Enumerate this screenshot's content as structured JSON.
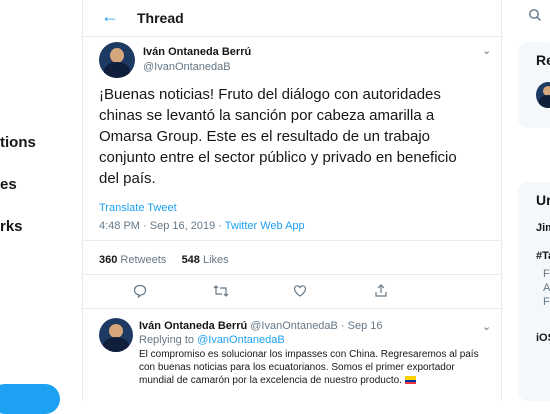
{
  "left_nav": {
    "items": [
      "tions",
      "es",
      "rks"
    ]
  },
  "header": {
    "title": "Thread"
  },
  "tweet": {
    "name": "Iván Ontaneda Berrú",
    "handle": "@IvanOntanedaB",
    "text": "¡Buenas noticias! Fruto del diálogo con autoridades chinas se levantó la sanción por cabeza amarilla a Omarsa Group. Este es el resultado de un trabajo conjunto entre el sector público y privado en beneficio del país.",
    "translate": "Translate Tweet",
    "time": "4:48 PM · Sep 16, 2019 · ",
    "source": "Twitter Web App",
    "retweets_count": "360",
    "retweets_label": "Retweets",
    "likes_count": "548",
    "likes_label": "Likes"
  },
  "reply": {
    "name": "Iván Ontaneda Berrú",
    "handle_date": "@IvanOntanedaB · Sep 16",
    "replying_prefix": "Replying to ",
    "replying_handle": "@IvanOntanedaB",
    "text": "El compromiso es solucionar los impasses con China. Regresaremos al país con buenas noticias para los ecuatorianos. Somos el primer exportador mundial de camarón por la excelencia de nuestro producto."
  },
  "right_rail": {
    "relevant_header": "Re",
    "trends_header": "Ur",
    "items": [
      "Jim",
      "#Ta",
      "F",
      "A",
      "F",
      "iOS"
    ]
  },
  "icons": {
    "back": "arrow-left-icon",
    "caret": "chevron-down-icon",
    "reply": "comment-icon",
    "retweet": "retweet-icon",
    "like": "heart-icon",
    "share": "share-icon",
    "search": "search-icon"
  },
  "colors": {
    "accent": "#1da1f2",
    "text": "#14171a",
    "muted": "#657786",
    "border": "#e6ecf0"
  }
}
